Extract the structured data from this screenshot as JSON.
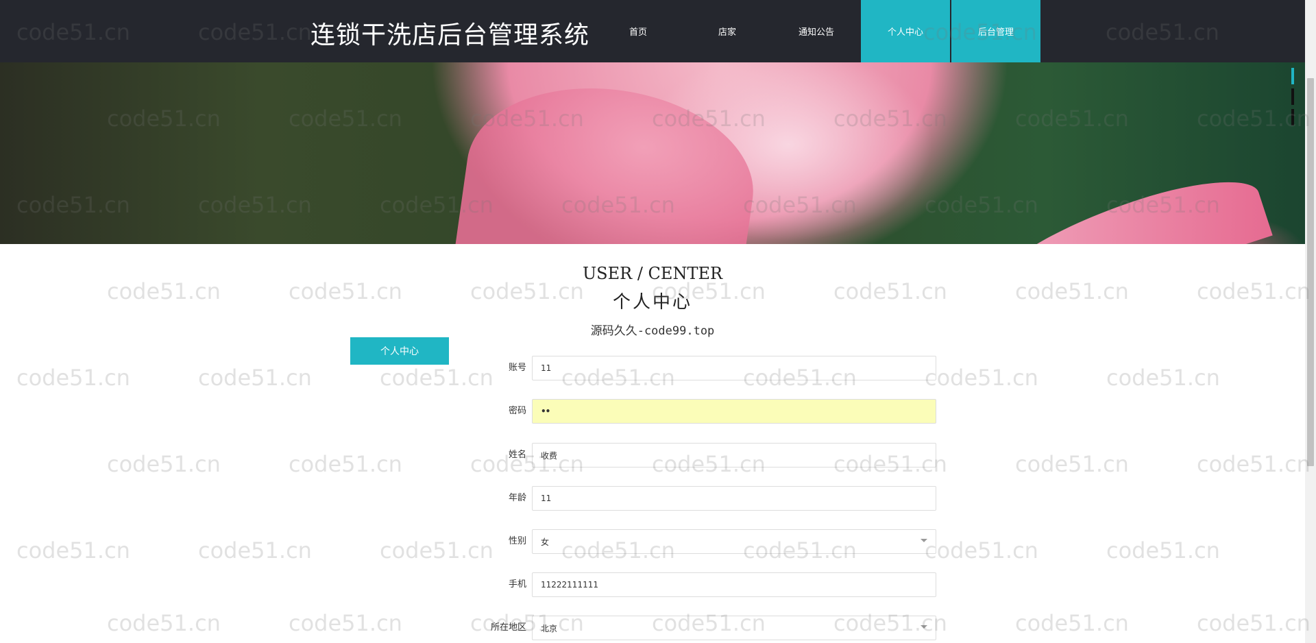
{
  "header": {
    "title": "连锁干洗店后台管理系统",
    "nav": [
      {
        "label": "首页"
      },
      {
        "label": "店家"
      },
      {
        "label": "通知公告"
      },
      {
        "label": "个人中心",
        "active": true
      },
      {
        "label": "后台管理",
        "active": true
      }
    ]
  },
  "section": {
    "title_en": "USER / CENTER",
    "title_cn": "个人中心",
    "subtitle": "源码久久-code99.top"
  },
  "sidebar": {
    "tab_label": "个人中心"
  },
  "form": {
    "fields": [
      {
        "label": "账号",
        "value": "11"
      },
      {
        "label": "密码",
        "value": "••"
      },
      {
        "label": "姓名",
        "value": "收费"
      },
      {
        "label": "年龄",
        "value": "11"
      },
      {
        "label": "性别",
        "value": "女"
      },
      {
        "label": "手机",
        "value": "11222111111"
      },
      {
        "label": "所在地区",
        "value": "北京"
      }
    ]
  },
  "watermark": {
    "text": "code51.cn"
  },
  "colors": {
    "accent": "#20b6c4",
    "header_bg": "#25272e",
    "password_bg": "#fbfdb8"
  }
}
